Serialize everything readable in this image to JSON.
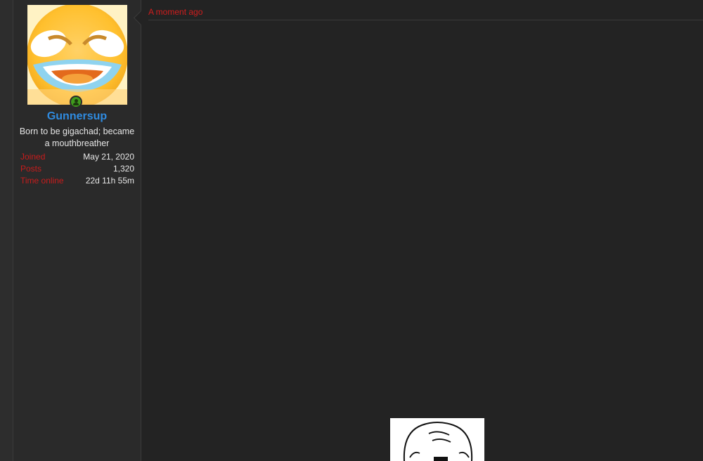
{
  "user": {
    "username": "Gunnersup",
    "title": "Born to be gigachad; became a mouthbreather",
    "avatar_icon": "laughing-crying-emoji-icon",
    "online_status_icon": "online-user-icon",
    "stats": [
      {
        "label": "Joined",
        "value": "May 21, 2020"
      },
      {
        "label": "Posts",
        "value": "1,320"
      },
      {
        "label": "Time online",
        "value": "22d 11h 55m"
      }
    ]
  },
  "post": {
    "timestamp": "A moment ago",
    "image_icon": "meme-face-image"
  },
  "colors": {
    "background": "#232323",
    "panel": "#2a2a2a",
    "username": "#2f8be0",
    "label_red": "#c81c1c",
    "online_green": "#3f9b1d"
  }
}
